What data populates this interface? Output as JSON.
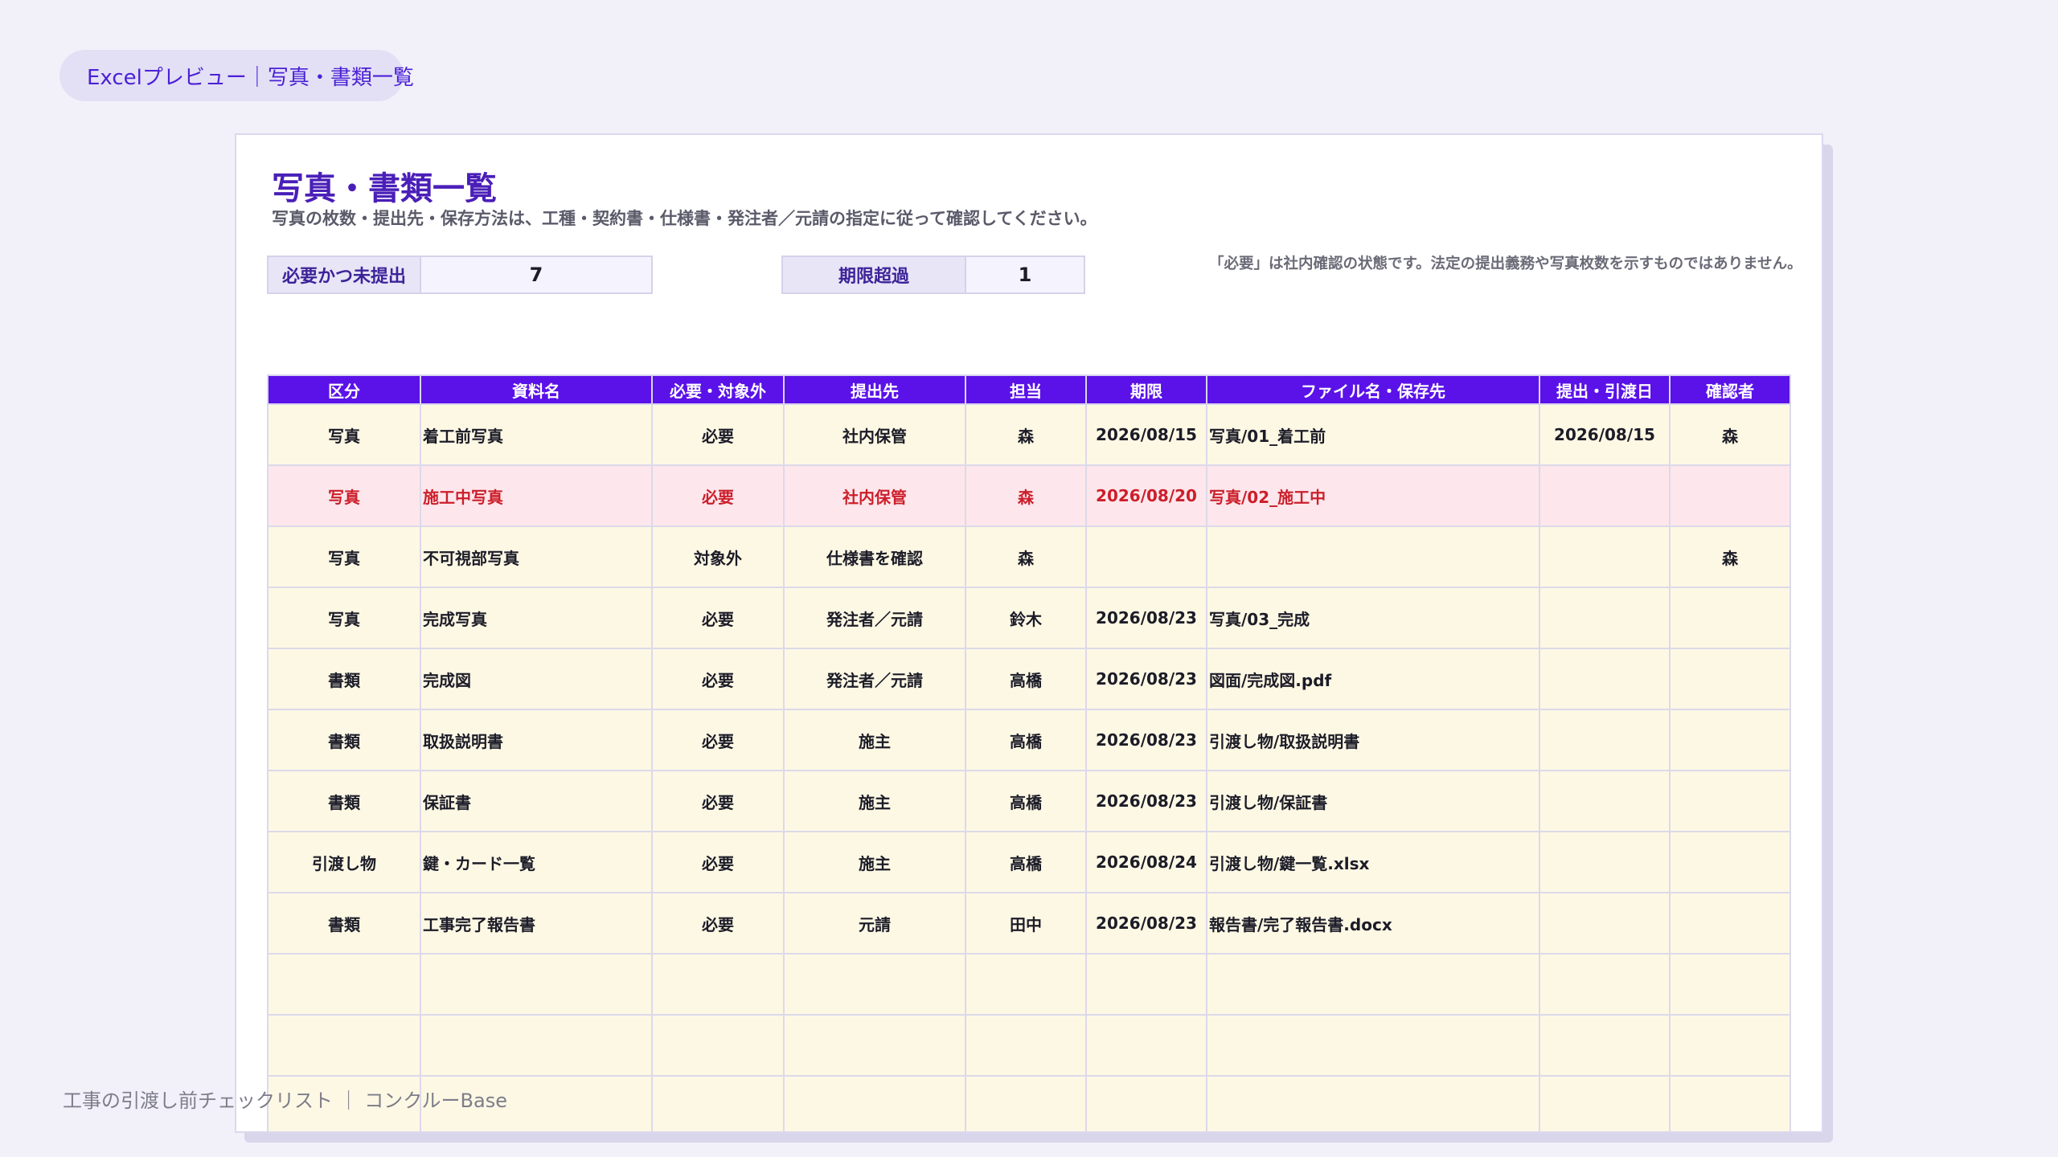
{
  "header": {
    "preview_label": "Excelプレビュー｜写真・書類一覧"
  },
  "sheet": {
    "title": "写真・書類一覧",
    "subtitle": "写真の枚数・提出先・保存方法は、工種・契約書・仕様書・発注者／元請の指定に従って確認してください。",
    "stats": [
      {
        "label": "必要かつ未提出",
        "value": "7"
      },
      {
        "label": "期限超過",
        "value": "1"
      }
    ],
    "note": "「必要」は社内確認の状態です。法定の提出義務や写真枚数を示すものではありません。",
    "table": {
      "headers": [
        "区分",
        "資料名",
        "必要・対象外",
        "提出先",
        "担当",
        "期限",
        "ファイル名・保存先",
        "提出・引渡日",
        "確認者"
      ],
      "rows": [
        [
          "写真",
          "着工前写真",
          "必要",
          "社内保管",
          "森",
          "2026/08/15",
          "写真/01_着工前",
          "2026/08/15",
          "森"
        ],
        [
          "写真",
          "施工中写真",
          "必要",
          "社内保管",
          "森",
          "2026/08/20",
          "写真/02_施工中",
          "",
          ""
        ],
        [
          "写真",
          "不可視部写真",
          "対象外",
          "仕様書を確認",
          "森",
          "",
          "",
          "",
          "森"
        ],
        [
          "写真",
          "完成写真",
          "必要",
          "発注者／元請",
          "鈴木",
          "2026/08/23",
          "写真/03_完成",
          "",
          ""
        ],
        [
          "書類",
          "完成図",
          "必要",
          "発注者／元請",
          "高橋",
          "2026/08/23",
          "図面/完成図.pdf",
          "",
          ""
        ],
        [
          "書類",
          "取扱説明書",
          "必要",
          "施主",
          "高橋",
          "2026/08/23",
          "引渡し物/取扱説明書",
          "",
          ""
        ],
        [
          "書類",
          "保証書",
          "必要",
          "施主",
          "高橋",
          "2026/08/23",
          "引渡し物/保証書",
          "",
          ""
        ],
        [
          "引渡し物",
          "鍵・カード一覧",
          "必要",
          "施主",
          "高橋",
          "2026/08/24",
          "引渡し物/鍵一覧.xlsx",
          "",
          ""
        ],
        [
          "書類",
          "工事完了報告書",
          "必要",
          "元請",
          "田中",
          "2026/08/23",
          "報告書/完了報告書.docx",
          "",
          ""
        ],
        [
          "",
          "",
          "",
          "",
          "",
          "",
          "",
          "",
          ""
        ],
        [
          "",
          "",
          "",
          "",
          "",
          "",
          "",
          "",
          ""
        ],
        [
          "",
          "",
          "",
          "",
          "",
          "",
          "",
          "",
          ""
        ]
      ],
      "highlighted_row_index": 1
    }
  },
  "footer": {
    "text": "工事の引渡し前チェックリスト ｜ コンクルーBase"
  },
  "colors": {
    "accent": "#5a12e8",
    "title": "#4a1fb8",
    "row_fill": "#fdf8e4",
    "alert_fill": "#fde7ec",
    "alert_text": "#cc1f2b",
    "background": "#f2f1fa"
  }
}
